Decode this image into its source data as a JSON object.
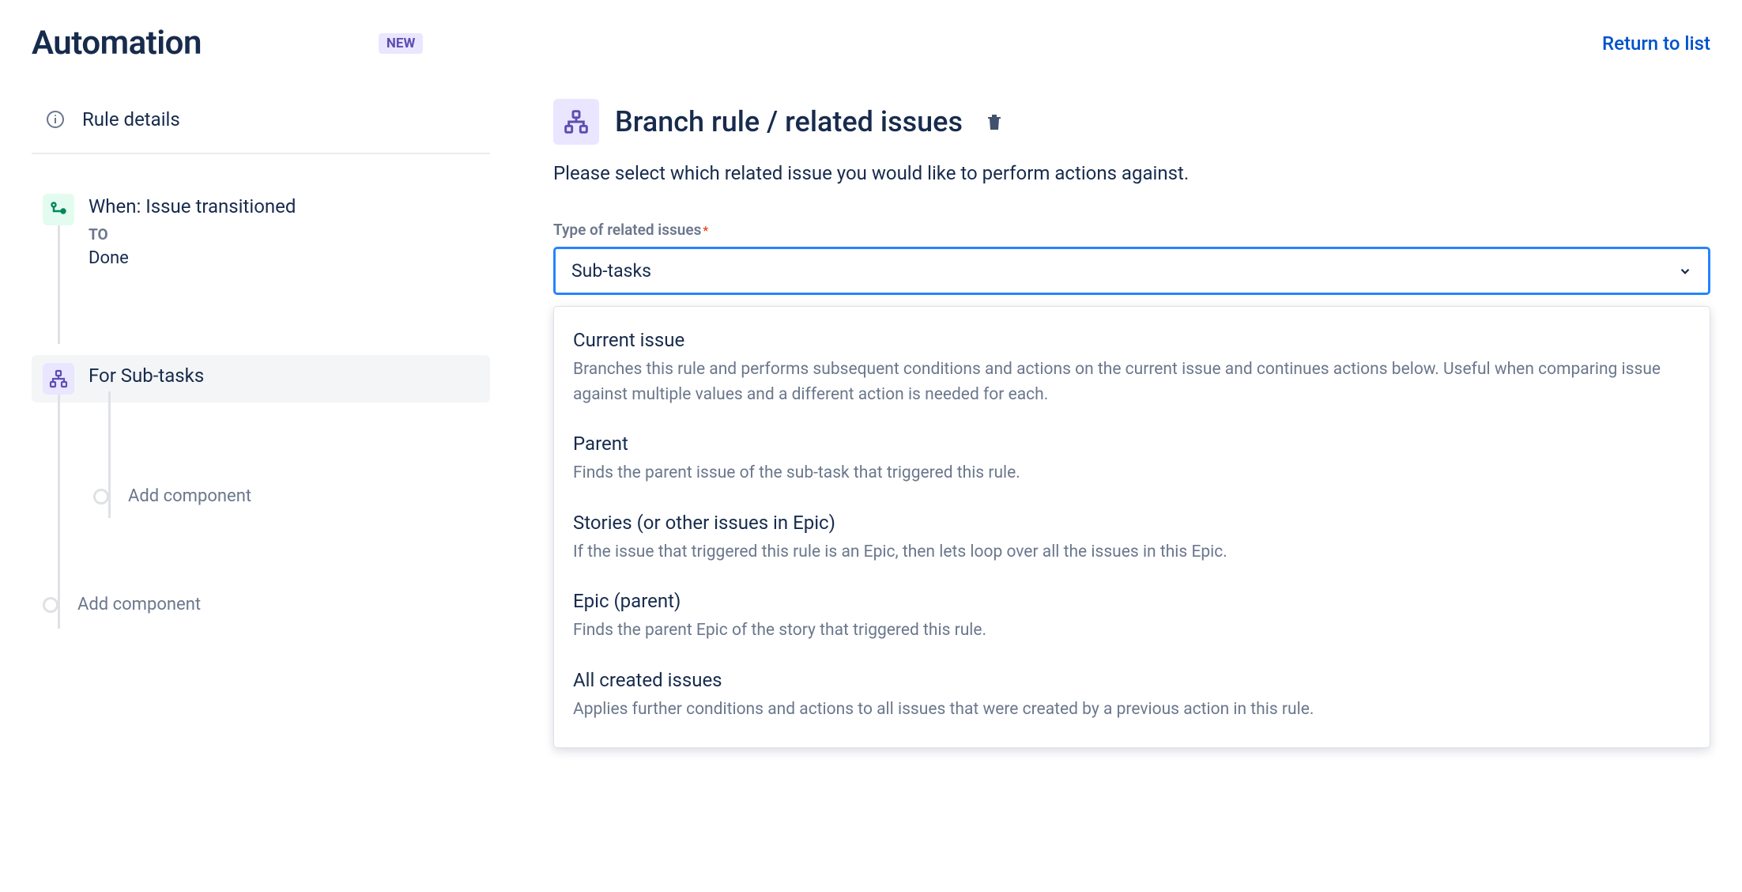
{
  "header": {
    "title": "Automation",
    "badge": "NEW",
    "return_link": "Return to list"
  },
  "sidebar": {
    "rule_details_label": "Rule details",
    "trigger": {
      "title": "When: Issue transitioned",
      "sub_label": "TO",
      "value": "Done"
    },
    "branch": {
      "title": "For Sub-tasks"
    },
    "add_component_label": "Add component"
  },
  "main": {
    "title": "Branch rule / related issues",
    "description": "Please select which related issue you would like to perform actions against.",
    "field_label": "Type of related issues",
    "selected_value": "Sub-tasks",
    "options": [
      {
        "title": "Current issue",
        "desc": "Branches this rule and performs subsequent conditions and actions on the current issue and continues actions below. Useful when comparing issue against multiple values and a different action is needed for each."
      },
      {
        "title": "Parent",
        "desc": "Finds the parent issue of the sub-task that triggered this rule."
      },
      {
        "title": "Stories (or other issues in Epic)",
        "desc": "If the issue that triggered this rule is an Epic, then lets loop over all the issues in this Epic."
      },
      {
        "title": "Epic (parent)",
        "desc": "Finds the parent Epic of the story that triggered this rule."
      },
      {
        "title": "All created issues",
        "desc": "Applies further conditions and actions to all issues that were created by a previous action in this rule."
      }
    ]
  }
}
